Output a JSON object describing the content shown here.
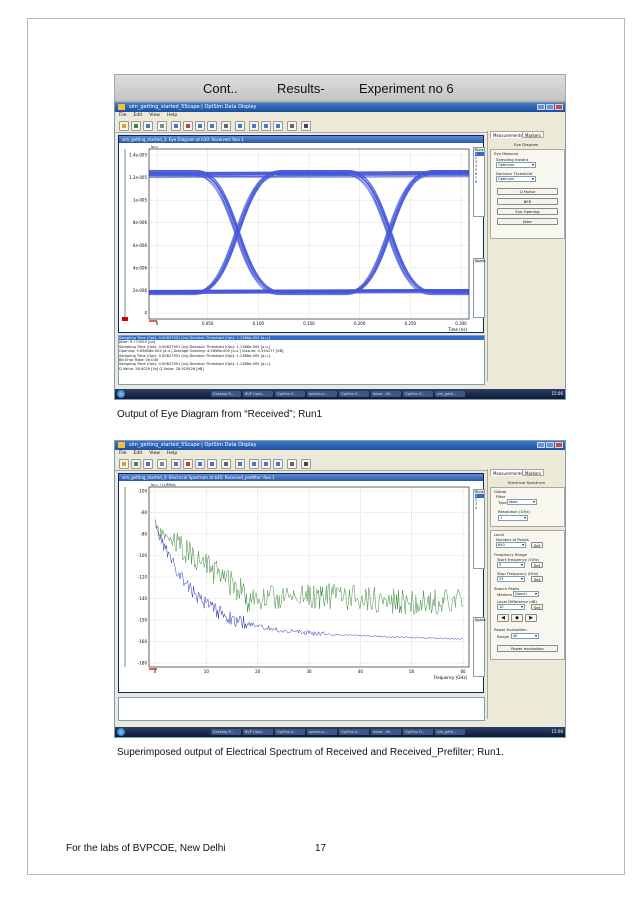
{
  "heading": {
    "cont": "Cont..",
    "results": "Results-",
    "experiment": "Experiment no 6"
  },
  "screenshot1": {
    "window_title": "sim_getting_started_5Scape | OptSim Data Display",
    "menu": [
      "File",
      "Edit",
      "View",
      "Help"
    ],
    "plot_window_title": "sim_getting_started_3: Eye Diagram at b30: Received: Run 1",
    "y_axis_unit": "Ia.u.",
    "y_ticks": [
      "1.4e-005",
      "1.2e-005",
      "1e-005",
      "8e-006",
      "6e-006",
      "4e-006",
      "2e-006",
      "0"
    ],
    "x_ticks": [
      "0",
      "0.050",
      "0.100",
      "0.150",
      "0.200",
      "0.250",
      "0.300"
    ],
    "x_axis_label": "Time (ns)",
    "runs_header": "Runs",
    "runs_items": [
      "1",
      "2",
      "3",
      "4",
      "5",
      "6",
      "7",
      "8"
    ],
    "spans_header": "Spans",
    "side_tabs": [
      "Measurements",
      "Markers"
    ],
    "side_section": "Eye Diagram",
    "eye_measure_label": "Eye Measure",
    "sampling_instant_label": "Sampling Instant",
    "sampling_instant_value": "Optimum",
    "decision_threshold_label": "Decision Threshold",
    "decision_threshold_value": "Optimum",
    "buttons": [
      "Q Factor",
      "BER",
      "Eye Opening",
      "Jitter"
    ],
    "info_lines": [
      "Sampling Time (Opt): 0.00627951 [ns]  Decision Threshold (Opt): 1.1386e-005 [a.u.]",
      "  Jitter: 9.771952 [ns]",
      "Sampling Time (Opt): 0.00627951 [ns]  Decision Threshold (Opt): 1.1386e-005 [a.u.]",
      "  Opening: 5.65658e-005 [a.u.]  Average Opening: 4.5858e-005 [a.u.]  Closure: 0.354177 [dB]",
      "Sampling Time (Opt): 0.00627951 [ns]  Decision Threshold (Opt): 1.1386e-005 [a.u.]",
      "  Bit Error Rate: 0e-040",
      "Sampling Time (Opt): 0.00627951 [ns]  Decision Threshold (Opt): 1.1386e-005 [a.u.]",
      "  Q Value: 26.0029 [lin]  Q Value: 28.925526 [dB]"
    ],
    "taskbar_items": [
      "Desktop R...",
      "BVP Optsi...",
      "OptSim S...",
      "optsim-p...",
      "OptSim S...",
      "Inbox - Mi...",
      "OptSim D...",
      "sim_getti..."
    ],
    "clock": "15:06"
  },
  "caption1": "Output of Eye Diagram from “Received”; Run1",
  "screenshot2": {
    "window_title": "sim_getting_started_5Scape | OptSim Data Display",
    "menu": [
      "File",
      "Edit",
      "View",
      "Help"
    ],
    "plot_window_title": "sim_getting_started_3: Electrical Spectrum at b35: Received_prefilter: Run 1",
    "y_axis_unit": "Ia.u. / (1/MHz)",
    "y_ticks": [
      "-100",
      "-60",
      "-80",
      "-100",
      "-120",
      "-140",
      "-150",
      "-160",
      "-180"
    ],
    "x_ticks": [
      "0",
      "10",
      "20",
      "30",
      "40",
      "50",
      "60"
    ],
    "x_axis_label": "Frequency (GHz)",
    "runs_header": "Runs",
    "runs_items": [
      "1",
      "2",
      "3",
      "4"
    ],
    "spans_header": "Spans",
    "side_tabs": [
      "Measurements",
      "Markers"
    ],
    "side_section": "Electrical Spectrum",
    "global_label": "Global",
    "filter_label": "Filter",
    "type_label": "Type",
    "type_value": "Ideal",
    "resolution_label": "Resolution (GHz)",
    "resolution_value": "1",
    "local_label": "Local",
    "points_label": "Number of Points",
    "points_value": "640",
    "freq_range_label": "Frequency Range",
    "start_freq_label": "Start Frequency (GHz)",
    "start_freq_value": "0",
    "stop_freq_label": "Stop Frequency (GHz)",
    "stop_freq_value": "25",
    "search_peaks_label": "Search Peaks",
    "markers_label": "Markers",
    "markers_value": "(None)",
    "level_diff_label": "Level Difference (dB)",
    "level_diff_value": "10",
    "set_label": "Set",
    "power_eval_label": "Power Evaluation",
    "range_label": "Range",
    "range_value": "All",
    "power_btn": "Power evaluation",
    "taskbar_items": [
      "Desktop R...",
      "BVP Optsi...",
      "OptSim S...",
      "optsim-p...",
      "OptSim S...",
      "Inbox - Mi...",
      "OptSim D...",
      "sim_getti..."
    ],
    "clock": "15:06"
  },
  "caption2": "Superimposed output of Electrical Spectrum of Received and Received_Prefilter; Run1.",
  "footer": {
    "left": "For the labs of BVPCOE, New Delhi",
    "page": "17"
  },
  "colors": {
    "eye_trace": "#1a2fd0",
    "spectrum_green": "#3c8a3c",
    "spectrum_blue": "#2a35b8",
    "title_bar": "#245ab0"
  }
}
